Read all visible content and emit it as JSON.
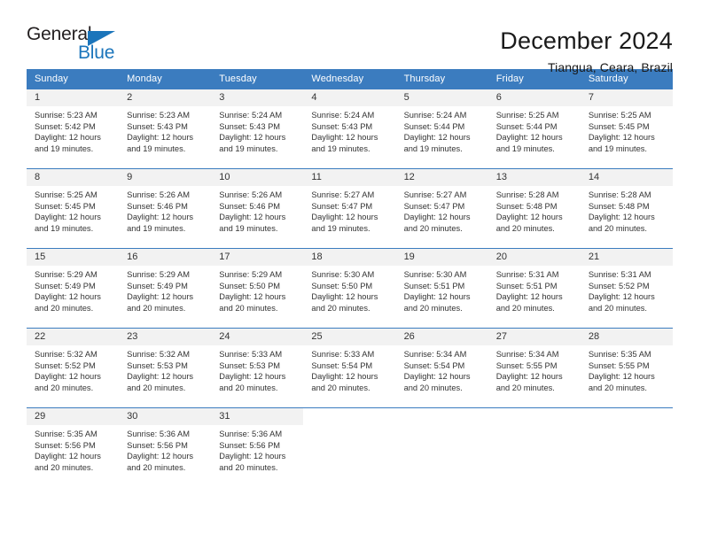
{
  "logo": {
    "word_top": "General",
    "word_bottom": "Blue",
    "triangle_icon": "blue-triangle-icon",
    "accent_color": "#1b75bb"
  },
  "header": {
    "title": "December 2024",
    "location": "Tiangua, Ceara, Brazil"
  },
  "theme": {
    "header_row_color": "#3b7cbf",
    "daynum_background": "#f2f2f2",
    "text_color": "#333333"
  },
  "calendar": {
    "weekday_headers": [
      "Sunday",
      "Monday",
      "Tuesday",
      "Wednesday",
      "Thursday",
      "Friday",
      "Saturday"
    ],
    "labels": {
      "sunrise": "Sunrise:",
      "sunset": "Sunset:",
      "daylight": "Daylight:"
    },
    "weeks": [
      [
        {
          "day": "1",
          "sunrise": "Sunrise: 5:23 AM",
          "sunset": "Sunset: 5:42 PM",
          "daylight_line1": "Daylight: 12 hours",
          "daylight_line2": "and 19 minutes."
        },
        {
          "day": "2",
          "sunrise": "Sunrise: 5:23 AM",
          "sunset": "Sunset: 5:43 PM",
          "daylight_line1": "Daylight: 12 hours",
          "daylight_line2": "and 19 minutes."
        },
        {
          "day": "3",
          "sunrise": "Sunrise: 5:24 AM",
          "sunset": "Sunset: 5:43 PM",
          "daylight_line1": "Daylight: 12 hours",
          "daylight_line2": "and 19 minutes."
        },
        {
          "day": "4",
          "sunrise": "Sunrise: 5:24 AM",
          "sunset": "Sunset: 5:43 PM",
          "daylight_line1": "Daylight: 12 hours",
          "daylight_line2": "and 19 minutes."
        },
        {
          "day": "5",
          "sunrise": "Sunrise: 5:24 AM",
          "sunset": "Sunset: 5:44 PM",
          "daylight_line1": "Daylight: 12 hours",
          "daylight_line2": "and 19 minutes."
        },
        {
          "day": "6",
          "sunrise": "Sunrise: 5:25 AM",
          "sunset": "Sunset: 5:44 PM",
          "daylight_line1": "Daylight: 12 hours",
          "daylight_line2": "and 19 minutes."
        },
        {
          "day": "7",
          "sunrise": "Sunrise: 5:25 AM",
          "sunset": "Sunset: 5:45 PM",
          "daylight_line1": "Daylight: 12 hours",
          "daylight_line2": "and 19 minutes."
        }
      ],
      [
        {
          "day": "8",
          "sunrise": "Sunrise: 5:25 AM",
          "sunset": "Sunset: 5:45 PM",
          "daylight_line1": "Daylight: 12 hours",
          "daylight_line2": "and 19 minutes."
        },
        {
          "day": "9",
          "sunrise": "Sunrise: 5:26 AM",
          "sunset": "Sunset: 5:46 PM",
          "daylight_line1": "Daylight: 12 hours",
          "daylight_line2": "and 19 minutes."
        },
        {
          "day": "10",
          "sunrise": "Sunrise: 5:26 AM",
          "sunset": "Sunset: 5:46 PM",
          "daylight_line1": "Daylight: 12 hours",
          "daylight_line2": "and 19 minutes."
        },
        {
          "day": "11",
          "sunrise": "Sunrise: 5:27 AM",
          "sunset": "Sunset: 5:47 PM",
          "daylight_line1": "Daylight: 12 hours",
          "daylight_line2": "and 19 minutes."
        },
        {
          "day": "12",
          "sunrise": "Sunrise: 5:27 AM",
          "sunset": "Sunset: 5:47 PM",
          "daylight_line1": "Daylight: 12 hours",
          "daylight_line2": "and 20 minutes."
        },
        {
          "day": "13",
          "sunrise": "Sunrise: 5:28 AM",
          "sunset": "Sunset: 5:48 PM",
          "daylight_line1": "Daylight: 12 hours",
          "daylight_line2": "and 20 minutes."
        },
        {
          "day": "14",
          "sunrise": "Sunrise: 5:28 AM",
          "sunset": "Sunset: 5:48 PM",
          "daylight_line1": "Daylight: 12 hours",
          "daylight_line2": "and 20 minutes."
        }
      ],
      [
        {
          "day": "15",
          "sunrise": "Sunrise: 5:29 AM",
          "sunset": "Sunset: 5:49 PM",
          "daylight_line1": "Daylight: 12 hours",
          "daylight_line2": "and 20 minutes."
        },
        {
          "day": "16",
          "sunrise": "Sunrise: 5:29 AM",
          "sunset": "Sunset: 5:49 PM",
          "daylight_line1": "Daylight: 12 hours",
          "daylight_line2": "and 20 minutes."
        },
        {
          "day": "17",
          "sunrise": "Sunrise: 5:29 AM",
          "sunset": "Sunset: 5:50 PM",
          "daylight_line1": "Daylight: 12 hours",
          "daylight_line2": "and 20 minutes."
        },
        {
          "day": "18",
          "sunrise": "Sunrise: 5:30 AM",
          "sunset": "Sunset: 5:50 PM",
          "daylight_line1": "Daylight: 12 hours",
          "daylight_line2": "and 20 minutes."
        },
        {
          "day": "19",
          "sunrise": "Sunrise: 5:30 AM",
          "sunset": "Sunset: 5:51 PM",
          "daylight_line1": "Daylight: 12 hours",
          "daylight_line2": "and 20 minutes."
        },
        {
          "day": "20",
          "sunrise": "Sunrise: 5:31 AM",
          "sunset": "Sunset: 5:51 PM",
          "daylight_line1": "Daylight: 12 hours",
          "daylight_line2": "and 20 minutes."
        },
        {
          "day": "21",
          "sunrise": "Sunrise: 5:31 AM",
          "sunset": "Sunset: 5:52 PM",
          "daylight_line1": "Daylight: 12 hours",
          "daylight_line2": "and 20 minutes."
        }
      ],
      [
        {
          "day": "22",
          "sunrise": "Sunrise: 5:32 AM",
          "sunset": "Sunset: 5:52 PM",
          "daylight_line1": "Daylight: 12 hours",
          "daylight_line2": "and 20 minutes."
        },
        {
          "day": "23",
          "sunrise": "Sunrise: 5:32 AM",
          "sunset": "Sunset: 5:53 PM",
          "daylight_line1": "Daylight: 12 hours",
          "daylight_line2": "and 20 minutes."
        },
        {
          "day": "24",
          "sunrise": "Sunrise: 5:33 AM",
          "sunset": "Sunset: 5:53 PM",
          "daylight_line1": "Daylight: 12 hours",
          "daylight_line2": "and 20 minutes."
        },
        {
          "day": "25",
          "sunrise": "Sunrise: 5:33 AM",
          "sunset": "Sunset: 5:54 PM",
          "daylight_line1": "Daylight: 12 hours",
          "daylight_line2": "and 20 minutes."
        },
        {
          "day": "26",
          "sunrise": "Sunrise: 5:34 AM",
          "sunset": "Sunset: 5:54 PM",
          "daylight_line1": "Daylight: 12 hours",
          "daylight_line2": "and 20 minutes."
        },
        {
          "day": "27",
          "sunrise": "Sunrise: 5:34 AM",
          "sunset": "Sunset: 5:55 PM",
          "daylight_line1": "Daylight: 12 hours",
          "daylight_line2": "and 20 minutes."
        },
        {
          "day": "28",
          "sunrise": "Sunrise: 5:35 AM",
          "sunset": "Sunset: 5:55 PM",
          "daylight_line1": "Daylight: 12 hours",
          "daylight_line2": "and 20 minutes."
        }
      ],
      [
        {
          "day": "29",
          "sunrise": "Sunrise: 5:35 AM",
          "sunset": "Sunset: 5:56 PM",
          "daylight_line1": "Daylight: 12 hours",
          "daylight_line2": "and 20 minutes."
        },
        {
          "day": "30",
          "sunrise": "Sunrise: 5:36 AM",
          "sunset": "Sunset: 5:56 PM",
          "daylight_line1": "Daylight: 12 hours",
          "daylight_line2": "and 20 minutes."
        },
        {
          "day": "31",
          "sunrise": "Sunrise: 5:36 AM",
          "sunset": "Sunset: 5:56 PM",
          "daylight_line1": "Daylight: 12 hours",
          "daylight_line2": "and 20 minutes."
        },
        {
          "day": "",
          "sunrise": "",
          "sunset": "",
          "daylight_line1": "",
          "daylight_line2": ""
        },
        {
          "day": "",
          "sunrise": "",
          "sunset": "",
          "daylight_line1": "",
          "daylight_line2": ""
        },
        {
          "day": "",
          "sunrise": "",
          "sunset": "",
          "daylight_line1": "",
          "daylight_line2": ""
        },
        {
          "day": "",
          "sunrise": "",
          "sunset": "",
          "daylight_line1": "",
          "daylight_line2": ""
        }
      ]
    ]
  }
}
